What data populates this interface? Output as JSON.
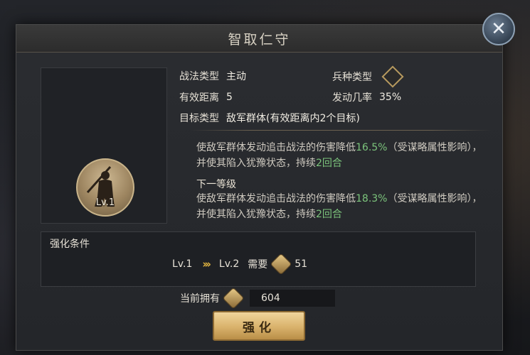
{
  "dialog": {
    "title": "智取仁守",
    "portrait": {
      "level": "Lv.1"
    },
    "info": {
      "tactic_type_label": "战法类型",
      "tactic_type_value": "主动",
      "troop_type_label": "兵种类型",
      "range_label": "有效距离",
      "range_value": "5",
      "trigger_label": "发动几率",
      "trigger_value": "35%",
      "target_label": "目标类型",
      "target_value": "敌军群体(有效距离内2个目标)"
    },
    "description": {
      "current_prefix": "使敌军群体发动追击战法的伤害降低",
      "current_value": "16.5%",
      "current_suffix": "（受谋略属性影响），并使其陷入犹豫状态，持续",
      "current_duration": "2回合",
      "next_level_label": "下一等级",
      "next_prefix": "使敌军群体发动追击战法的伤害降低",
      "next_value": "18.3%",
      "next_suffix": "（受谋略属性影响），并使其陷入犹豫状态，持续",
      "next_duration": "2回合"
    },
    "enhance_conditions": {
      "title": "强化条件",
      "from_level": "Lv.1",
      "to_level": "Lv.2",
      "need_label": "需要",
      "need_amount": "51"
    },
    "owned": {
      "label": "当前拥有",
      "amount": "604"
    },
    "enhance_button_label": "强化",
    "close_icon": "close-icon",
    "accent_color": "#7cc47c"
  }
}
